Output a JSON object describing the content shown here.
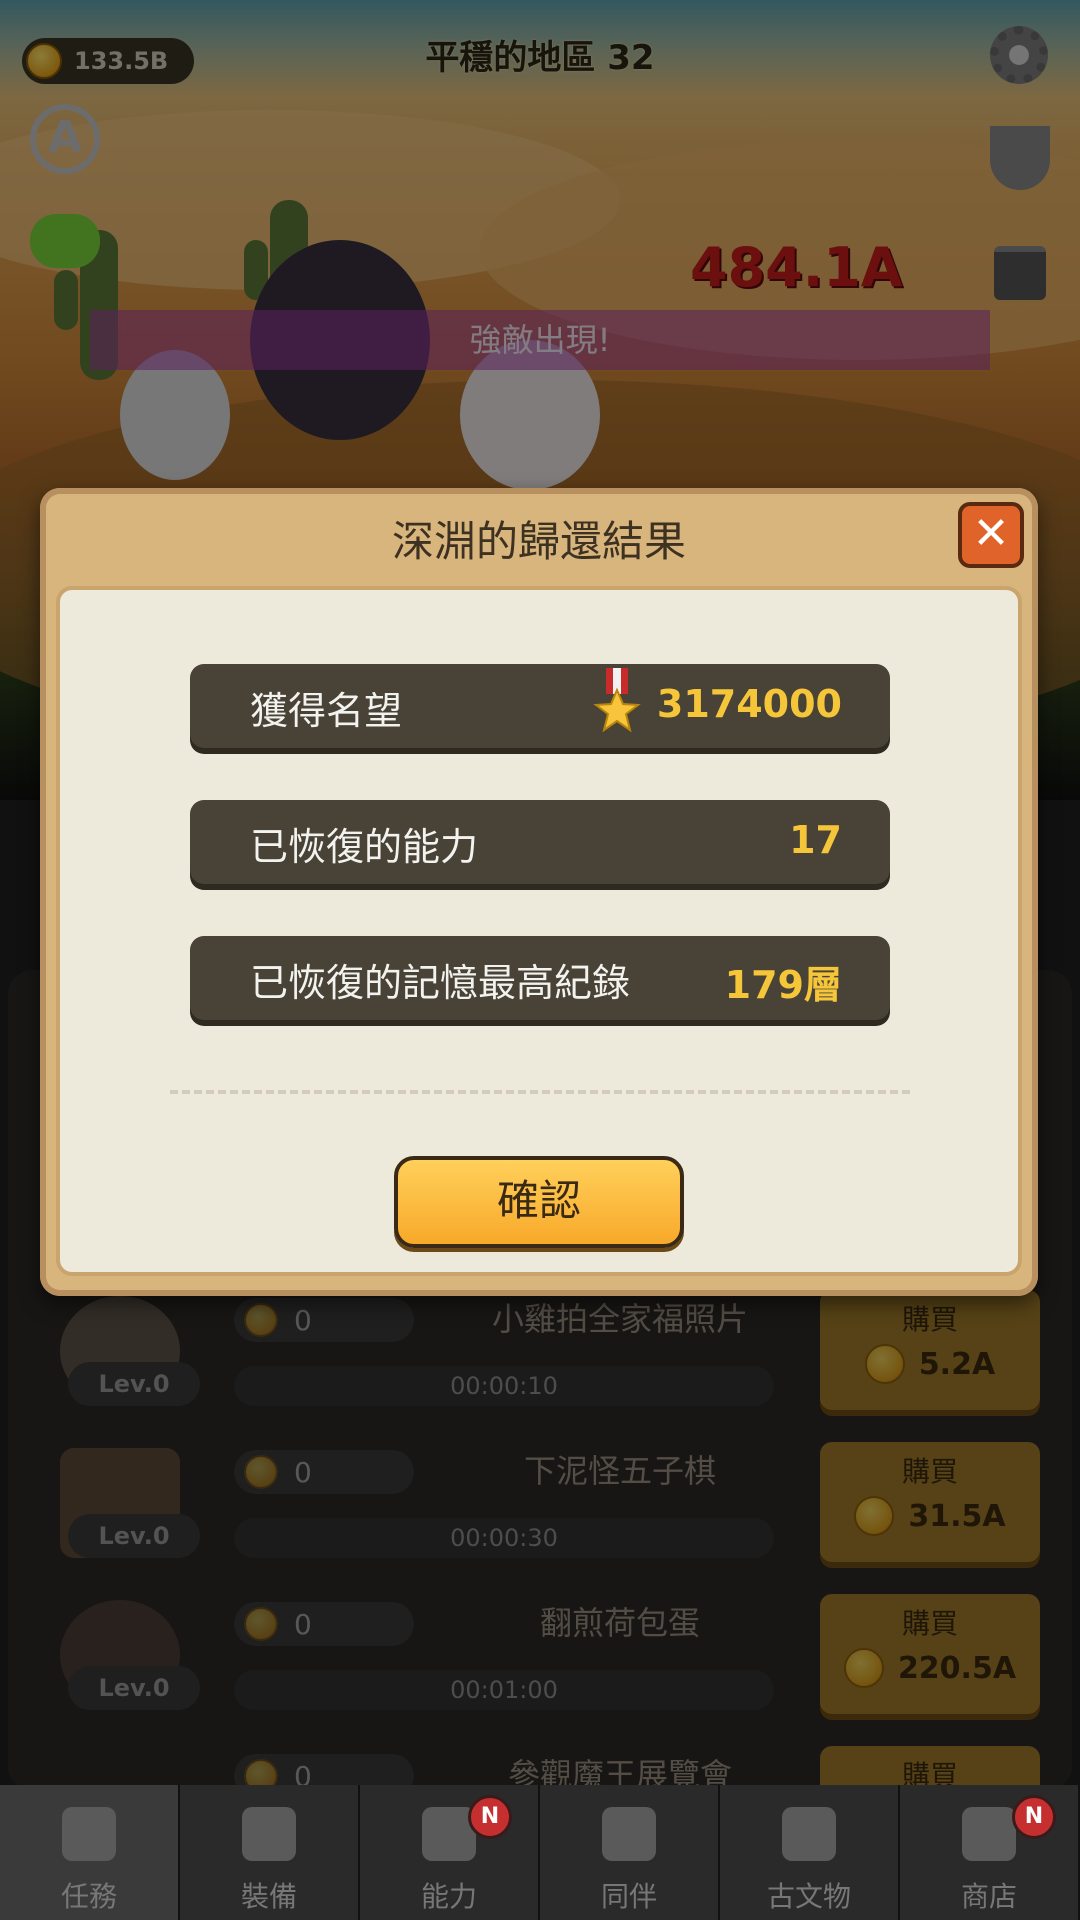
{
  "header": {
    "coins": "133.5B",
    "stage_title": "平穩的地區",
    "stage_number": "32",
    "damage": "484.1A",
    "banner": "強敵出現!"
  },
  "modal": {
    "title": "深淵的歸還結果",
    "rows": [
      {
        "label": "獲得名望",
        "value": "3174000"
      },
      {
        "label": "已恢復的能力",
        "value": "17"
      },
      {
        "label": "已恢復的記憶最高紀錄",
        "value": "179層"
      }
    ],
    "confirm_label": "確認",
    "close_symbol": "✕"
  },
  "list": {
    "rows": [
      {
        "name": "小雞拍全家福照片",
        "count": "0",
        "level": "Lev.0",
        "timer": "00:00:10",
        "buy_label": "購買",
        "price": "5.2A"
      },
      {
        "name": "下泥怪五子棋",
        "count": "0",
        "level": "Lev.0",
        "timer": "00:00:30",
        "buy_label": "購買",
        "price": "31.5A"
      },
      {
        "name": "翻煎荷包蛋",
        "count": "0",
        "level": "Lev.0",
        "timer": "00:01:00",
        "buy_label": "購買",
        "price": "220.5A"
      },
      {
        "name": "參觀魔王展覽會",
        "count": "0",
        "level": "",
        "timer": "",
        "buy_label": "購買",
        "price": ""
      }
    ]
  },
  "nav": {
    "tabs": [
      {
        "label": "任務",
        "icon": "list-icon",
        "badge": ""
      },
      {
        "label": "裝備",
        "icon": "equipment-icon",
        "badge": ""
      },
      {
        "label": "能力",
        "icon": "ability-icon",
        "badge": "N"
      },
      {
        "label": "同伴",
        "icon": "companions-icon",
        "badge": ""
      },
      {
        "label": "古文物",
        "icon": "chest-icon",
        "badge": ""
      },
      {
        "label": "商店",
        "icon": "shop-bag-icon",
        "badge": "N"
      }
    ]
  },
  "colors": {
    "accent_gold": "#f6c63a",
    "modal_frame": "#d9b57e",
    "confirm_button": "#f8a92a",
    "close_button": "#e0642a",
    "damage_red": "#c81d1d"
  }
}
